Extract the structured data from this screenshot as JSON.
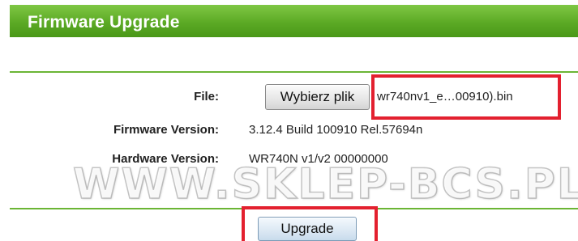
{
  "header": {
    "title": "Firmware Upgrade"
  },
  "form": {
    "file_label": "File:",
    "choose_file_button": "Wybierz plik",
    "file_name": "wr740nv1_e…00910).bin",
    "firmware_version_label": "Firmware Version:",
    "firmware_version_value": "3.12.4 Build 100910 Rel.57694n",
    "hardware_version_label": "Hardware Version:",
    "hardware_version_value": "WR740N v1/v2 00000000"
  },
  "actions": {
    "upgrade_button": "Upgrade"
  },
  "watermark": {
    "text": "WWW.SKLEP-BCS.PL"
  },
  "colors": {
    "header_green": "#5caa25",
    "rule_green": "#6bb535",
    "highlight_red": "#e3202f"
  }
}
